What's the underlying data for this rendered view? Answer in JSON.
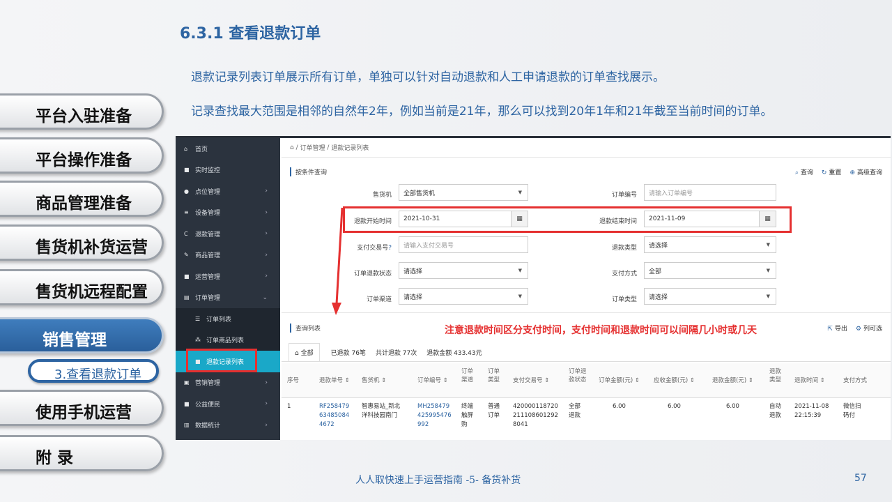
{
  "slide": {
    "title": "6.3.1 查看退款订单",
    "para1": "退款记录列表订单展示所有订单，单独可以针对自动退款和人工申请退款的订单查找展示。",
    "para2": "记录查找最大范围是相邻的自然年2年，例如当前是21年，那么可以找到20年1年和21年截至当前时间的订单。",
    "footer": "人人取快速上手运营指南 -5- 备货补货",
    "page": "57"
  },
  "nav": {
    "items": [
      "平台入驻准备",
      "平台操作准备",
      "商品管理准备",
      "售货机补货运营",
      "售货机远程配置",
      "销售管理",
      "使用手机运营",
      "附 录"
    ],
    "sub": "3.查看退款订单"
  },
  "app": {
    "sidebar": [
      {
        "icon": "home-icon",
        "glyph": "⌂",
        "label": "首页",
        "arrow": ""
      },
      {
        "icon": "camera-icon",
        "glyph": "■",
        "label": "实时监控",
        "arrow": ""
      },
      {
        "icon": "location-icon",
        "glyph": "●",
        "label": "点位管理",
        "arrow": "›"
      },
      {
        "icon": "device-icon",
        "glyph": "≡",
        "label": "设备管理",
        "arrow": "›"
      },
      {
        "icon": "refresh-icon",
        "glyph": "C",
        "label": "退款管理",
        "arrow": "›"
      },
      {
        "icon": "edit-icon",
        "glyph": "✎",
        "label": "商品管理",
        "arrow": "›"
      },
      {
        "icon": "bookmark-icon",
        "glyph": "■",
        "label": "运营管理",
        "arrow": "›"
      },
      {
        "icon": "order-icon",
        "glyph": "▤",
        "label": "订单管理",
        "arrow": "⌄"
      },
      {
        "icon": "list-icon",
        "glyph": "☰",
        "label": "订单列表",
        "arrow": "",
        "sub": true
      },
      {
        "icon": "sitemap-icon",
        "glyph": "⁂",
        "label": "订单商品列表",
        "arrow": "",
        "sub": true
      },
      {
        "icon": "square-icon",
        "glyph": "■",
        "label": "退款记录列表",
        "arrow": "",
        "sub": true,
        "active": true
      },
      {
        "icon": "gift-icon",
        "glyph": "▣",
        "label": "营销管理",
        "arrow": "›"
      },
      {
        "icon": "square-icon",
        "glyph": "■",
        "label": "公益便民",
        "arrow": "›"
      },
      {
        "icon": "chart-icon",
        "glyph": "▥",
        "label": "数据统计",
        "arrow": "›"
      }
    ],
    "breadcrumb": {
      "home": "⌂",
      "sep": "/",
      "a": "订单管理",
      "b": "退款记录列表"
    },
    "search_title": "按条件查询",
    "tools": {
      "query": "查询",
      "reset": "重置",
      "advanced": "高级查询"
    },
    "form": {
      "vending_label": "售货机",
      "vending_value": "全部售货机",
      "orderno_label": "订单编号",
      "orderno_ph": "请输入订单编号",
      "start_label": "退款开始时间",
      "start_value": "2021-10-31",
      "end_label": "退款结束时间",
      "end_value": "2021-11-09",
      "txn_label": "支付交易号",
      "txn_ph": "请输入支付交易号",
      "refundtype_label": "退款类型",
      "refundtype_value": "请选择",
      "status_label": "订单退款状态",
      "status_value": "请选择",
      "paymethod_label": "支付方式",
      "paymethod_value": "全部",
      "channel_label": "订单渠道",
      "channel_value": "请选择",
      "ordertype_label": "订单类型",
      "ordertype_value": "请选择"
    },
    "list_title": "查询列表",
    "note": "注意退款时间区分支付时间，支付时间和退款时间可以间隔几小时或几天",
    "export": "导出",
    "columns_btn": "列可选",
    "tabs": {
      "all": "全部",
      "refunded": "已退款 76笔",
      "total": "共计退款 77次",
      "amount": "退款金额 433.43元"
    },
    "headers": [
      "序号",
      "退款单号 ⇕",
      "售货机 ⇕",
      "订单编号 ⇕",
      "订单\n渠道",
      "订单\n类型",
      "支付交易号 ⇕",
      "订单退\n款状态",
      "订单金额(元) ⇕",
      "应收金额(元) ⇕",
      "退款金额(元) ⇕",
      "退款\n类型",
      "退款时间 ⇕",
      "支付方式"
    ],
    "row": [
      "1",
      "RF258479\n63485084\n4672",
      "智惠易站_新北\n洋科技园南门",
      "MH258479\n425995476\n992",
      "终端\n触屏\n购",
      "普通\n订单",
      "420000118720\n211108601292\n8041",
      "全部\n退款",
      "6.00",
      "6.00",
      "6.00",
      "自动\n退款",
      "2021-11-08\n22:15:39",
      "微信扫\n码付"
    ]
  }
}
